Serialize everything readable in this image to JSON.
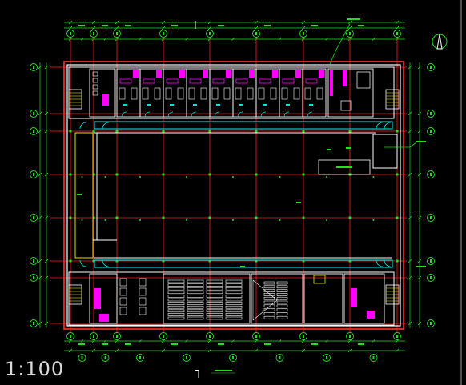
{
  "drawing": {
    "scale_label": "1:100",
    "colors": {
      "background": "#000000",
      "wall": "#ffffff",
      "axis": "#ff2020",
      "dimension": "#20e020",
      "bubble": "#20e020",
      "corridor": "#00e0e0",
      "room_fill": "#ff00ff",
      "outline": "#ff3030",
      "yellow": "#e0e000",
      "stair": "#e0e000"
    },
    "icons": [
      "north-arrow-icon",
      "section-mark-icon"
    ]
  }
}
